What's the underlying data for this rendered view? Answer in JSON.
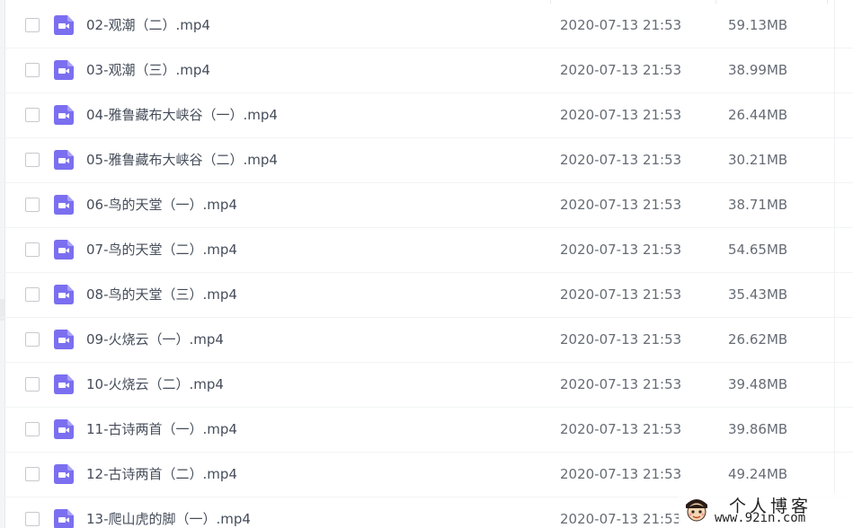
{
  "file_list": {
    "rows": [
      {
        "name": "02-观潮（二）.mp4",
        "date": "2020-07-13 21:53",
        "size": "59.13MB"
      },
      {
        "name": "03-观潮（三）.mp4",
        "date": "2020-07-13 21:53",
        "size": "38.99MB"
      },
      {
        "name": "04-雅鲁藏布大峡谷（一）.mp4",
        "date": "2020-07-13 21:53",
        "size": "26.44MB"
      },
      {
        "name": "05-雅鲁藏布大峡谷（二）.mp4",
        "date": "2020-07-13 21:53",
        "size": "30.21MB"
      },
      {
        "name": "06-鸟的天堂（一）.mp4",
        "date": "2020-07-13 21:53",
        "size": "38.71MB"
      },
      {
        "name": "07-鸟的天堂（二）.mp4",
        "date": "2020-07-13 21:53",
        "size": "54.65MB"
      },
      {
        "name": "08-鸟的天堂（三）.mp4",
        "date": "2020-07-13 21:53",
        "size": "35.43MB"
      },
      {
        "name": "09-火烧云（一）.mp4",
        "date": "2020-07-13 21:53",
        "size": "26.62MB"
      },
      {
        "name": "10-火烧云（二）.mp4",
        "date": "2020-07-13 21:53",
        "size": "39.48MB"
      },
      {
        "name": "11-古诗两首（一）.mp4",
        "date": "2020-07-13 21:53",
        "size": "39.86MB"
      },
      {
        "name": "12-古诗两首（二）.mp4",
        "date": "2020-07-13 21:53",
        "size": "49.24MB"
      },
      {
        "name": "13-爬山虎的脚（一）.mp4",
        "date": "2020-07-13 21:53",
        "size": ""
      }
    ],
    "icon": "video-file-icon",
    "icon_color": "#7b6ff0"
  },
  "watermark": {
    "title": "个人博客",
    "url": "www.92in.com"
  }
}
